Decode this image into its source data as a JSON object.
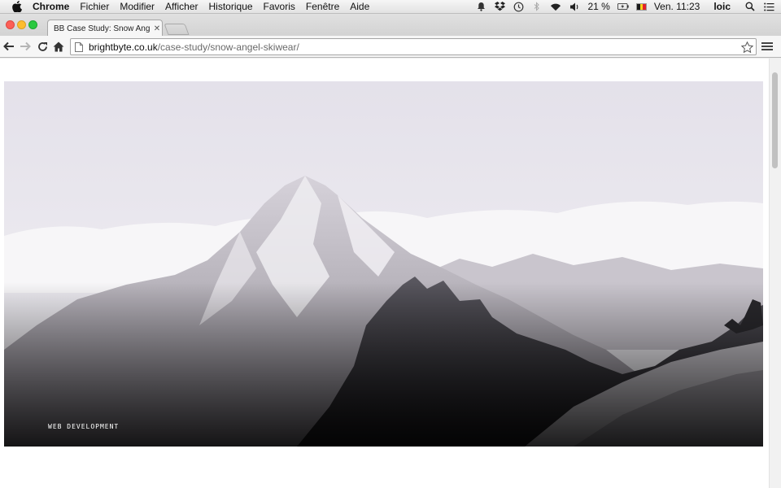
{
  "menubar": {
    "app": "Chrome",
    "items": [
      "Fichier",
      "Modifier",
      "Afficher",
      "Historique",
      "Favoris",
      "Fenêtre",
      "Aide"
    ],
    "battery": "21 %",
    "clock": "Ven. 11:23",
    "user": "loic",
    "status_icons": [
      "bell-icon",
      "dropbox-icon",
      "time-machine-icon",
      "bluetooth-icon",
      "wifi-icon",
      "volume-icon",
      "battery-icon",
      "flag-icon",
      "spotlight-icon",
      "notification-center-icon"
    ]
  },
  "browser": {
    "tab_title": "BB Case Study: Snow Angel S",
    "url_domain": "brightbyte.co.uk",
    "url_path": "/case-study/snow-angel-skiwear/"
  },
  "page": {
    "hero_label": "WEB DEVELOPMENT"
  },
  "colors": {
    "close": "#fc5f57",
    "minimize": "#fdbd2e",
    "maximize": "#2ac940",
    "sky": "#e7e4ec"
  }
}
